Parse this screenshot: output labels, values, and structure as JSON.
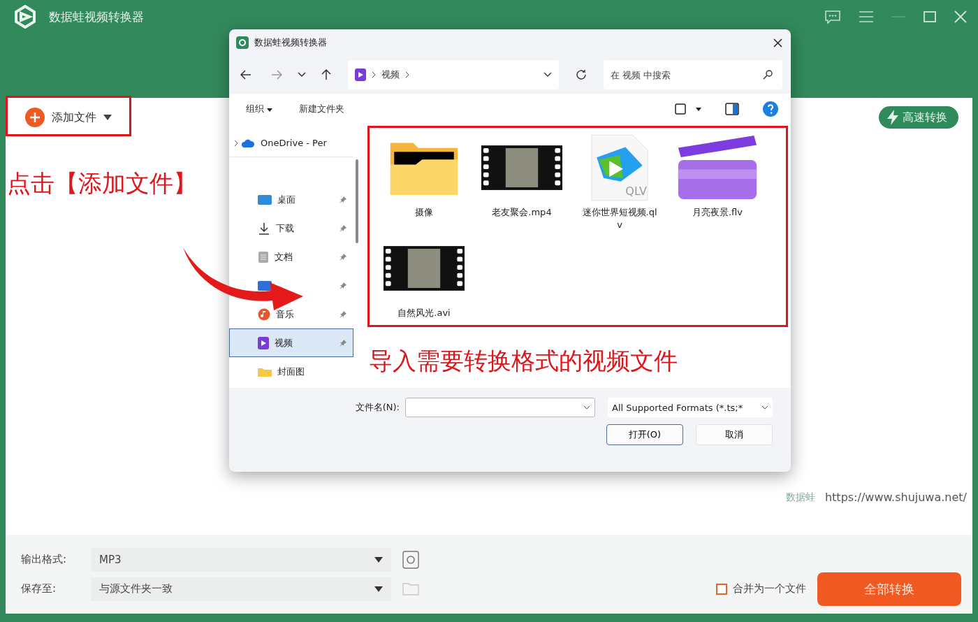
{
  "app": {
    "title": "数据蛙视频转换器"
  },
  "toolbar": {
    "add_button": "添加文件",
    "fast_convert": "高速转换"
  },
  "annotations": {
    "step1": "点击【添加文件】",
    "step2": "导入需要转换格式的视频文件"
  },
  "dialog": {
    "title": "数据蛙视频转换器",
    "address": "视频",
    "search_placeholder": "在 视频 中搜索",
    "organize": "组织",
    "new_folder": "新建文件夹",
    "nav": [
      {
        "label": "OneDrive - Per",
        "kind": "cloud",
        "pinned": false,
        "selected": false
      },
      {
        "label": "桌面",
        "kind": "desktop",
        "pinned": true,
        "selected": false
      },
      {
        "label": "下载",
        "kind": "download",
        "pinned": true,
        "selected": false
      },
      {
        "label": "文档",
        "kind": "document",
        "pinned": true,
        "selected": false
      },
      {
        "kind": "picture",
        "pinned": true,
        "selected": false
      },
      {
        "label": "音乐",
        "kind": "music",
        "pinned": true,
        "selected": false
      },
      {
        "label": "视频",
        "kind": "video",
        "pinned": true,
        "selected": true
      },
      {
        "label": "封面图",
        "kind": "folder",
        "pinned": false,
        "selected": false
      }
    ],
    "files": [
      {
        "name": "摄像",
        "kind": "folder"
      },
      {
        "name": "老友聚会.mp4",
        "kind": "film"
      },
      {
        "name": "迷你世界短视频.qlv",
        "kind": "qlv",
        "badge": "QLV"
      },
      {
        "name": "月亮夜景.flv",
        "kind": "clapper"
      },
      {
        "name": "自然风光.avi",
        "kind": "film"
      }
    ],
    "filename_label": "文件名(N):",
    "filter": "All Supported Formats (*.ts;*",
    "open": "打开(O)",
    "cancel": "取消"
  },
  "brand": {
    "mark": "数据蛙",
    "url": "https://www.shujuwa.net/"
  },
  "bottom": {
    "format_label": "输出格式:",
    "format": "MP3",
    "save_label": "保存至:",
    "save": "与源文件夹一致",
    "merge": {
      "label": "合并为一个文件",
      "checked": false
    },
    "convert": "全部转换"
  }
}
